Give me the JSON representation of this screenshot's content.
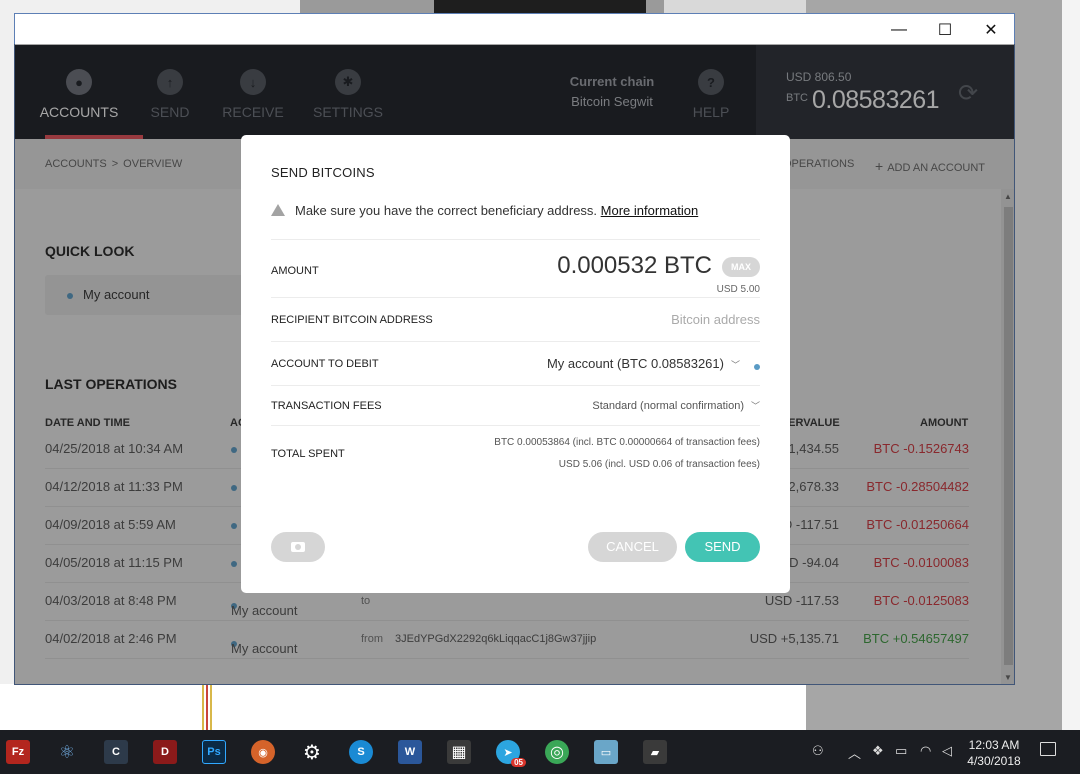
{
  "window": {
    "min_glyph": "—",
    "max_glyph": "☐",
    "close_glyph": "✕"
  },
  "nav": {
    "items": [
      {
        "label": "ACCOUNTS",
        "icon": "users-icon",
        "glyph": "●",
        "active": true
      },
      {
        "label": "SEND",
        "icon": "arrow-up-icon",
        "glyph": "↑",
        "active": false
      },
      {
        "label": "RECEIVE",
        "icon": "arrow-down-icon",
        "glyph": "↓",
        "active": false
      },
      {
        "label": "SETTINGS",
        "icon": "gear-icon",
        "glyph": "✱",
        "active": false
      }
    ],
    "chain_title": "Current chain",
    "chain_value": "Bitcoin Segwit",
    "help_label": "HELP",
    "help_glyph": "?",
    "usd_balance": "USD 806.50",
    "btc_label": "BTC",
    "btc_balance": "0.08583261",
    "sync_glyph": "⟳"
  },
  "subbar": {
    "crumb_root": "ACCOUNTS",
    "crumb_sep": ">",
    "crumb_current": "OVERVIEW",
    "operations_link": "OPERATIONS",
    "add_account": "ADD AN ACCOUNT",
    "add_glyph": "+"
  },
  "content": {
    "quick_look_title": "QUICK LOOK",
    "account_card_label": "My account",
    "last_ops_title": "LAST OPERATIONS",
    "headers": {
      "date": "DATE AND TIME",
      "account": "AC",
      "countervalue": "COUNTERVALUE",
      "amount": "AMOUNT"
    },
    "operations": [
      {
        "date": "04/25/2018 at 10:34 AM",
        "account": "",
        "dir": "",
        "address": "",
        "countervalue": "USD -1,434.55",
        "amount": "BTC -0.1526743",
        "sign": "neg"
      },
      {
        "date": "04/12/2018 at 11:33 PM",
        "account": "",
        "dir": "",
        "address": "",
        "countervalue": "USD -2,678.33",
        "amount": "BTC -0.28504482",
        "sign": "neg"
      },
      {
        "date": "04/09/2018 at 5:59 AM",
        "account": "",
        "dir": "",
        "address": "",
        "countervalue": "USD -117.51",
        "amount": "BTC -0.01250664",
        "sign": "neg"
      },
      {
        "date": "04/05/2018 at 11:15 PM",
        "account": "",
        "dir": "",
        "address": "",
        "countervalue": "USD -94.04",
        "amount": "BTC -0.0100083",
        "sign": "neg"
      },
      {
        "date": "04/03/2018 at 8:48 PM",
        "account": "My account",
        "dir": "to",
        "address": "",
        "countervalue": "USD -117.53",
        "amount": "BTC -0.0125083",
        "sign": "neg"
      },
      {
        "date": "04/02/2018 at 2:46 PM",
        "account": "My account",
        "dir": "from",
        "address": "3JEdYPGdX2292q6kLiqqacC1j8Gw37jjip",
        "countervalue": "USD +5,135.71",
        "amount": "BTC +0.54657497",
        "sign": "pos"
      }
    ]
  },
  "modal": {
    "title": "SEND BITCOINS",
    "warning_text": "Make sure you have the correct beneficiary address.",
    "warning_link": "More information",
    "amount_label": "AMOUNT",
    "amount_value": "0.000532",
    "amount_unit": "BTC",
    "max_label": "MAX",
    "amount_usd": "USD 5.00",
    "recipient_label": "RECIPIENT BITCOIN ADDRESS",
    "recipient_placeholder": "Bitcoin address",
    "recipient_value": "",
    "debit_label": "ACCOUNT TO DEBIT",
    "debit_value": "My account (BTC 0.08583261)",
    "fees_label": "TRANSACTION FEES",
    "fees_value": "Standard (normal confirmation)",
    "total_label": "TOTAL SPENT",
    "total_btc": "BTC 0.00053864 (incl. BTC 0.00000664 of transaction fees)",
    "total_usd": "USD 5.06 (incl. USD 0.06 of transaction fees)",
    "cancel_label": "CANCEL",
    "send_label": "SEND"
  },
  "taskbar": {
    "time": "12:03 AM",
    "date": "4/30/2018",
    "badge": "05",
    "apps": [
      {
        "name": "filezilla-icon",
        "glyph": "Fz",
        "color": "#b3261e"
      },
      {
        "name": "atom-icon",
        "glyph": "⚛",
        "color": "#1b1d22"
      },
      {
        "name": "cursor-app-icon",
        "glyph": "C",
        "color": "#2d3a4a"
      },
      {
        "name": "dragon-app-icon",
        "glyph": "D",
        "color": "#8b1a1a"
      },
      {
        "name": "photoshop-icon",
        "glyph": "Ps",
        "color": "#0b2a45"
      },
      {
        "name": "firefox-icon",
        "glyph": "◉",
        "color": "#d5632a"
      },
      {
        "name": "gear-icon",
        "glyph": "⚙",
        "color": "#1b1d22"
      },
      {
        "name": "skype-icon",
        "glyph": "S",
        "color": "#1a8ad4"
      },
      {
        "name": "word-icon",
        "glyph": "W",
        "color": "#2b579a"
      },
      {
        "name": "calculator-icon",
        "glyph": "▦",
        "color": "#3a3a3a"
      },
      {
        "name": "telegram-icon",
        "glyph": "➤",
        "color": "#2ca5e0"
      },
      {
        "name": "chrome-icon",
        "glyph": "◎",
        "color": "#3aa757"
      },
      {
        "name": "notes-app-icon",
        "glyph": "▭",
        "color": "#6aa6c8"
      },
      {
        "name": "ledger-app-icon",
        "glyph": "▰",
        "color": "#3a3a3a"
      }
    ]
  }
}
